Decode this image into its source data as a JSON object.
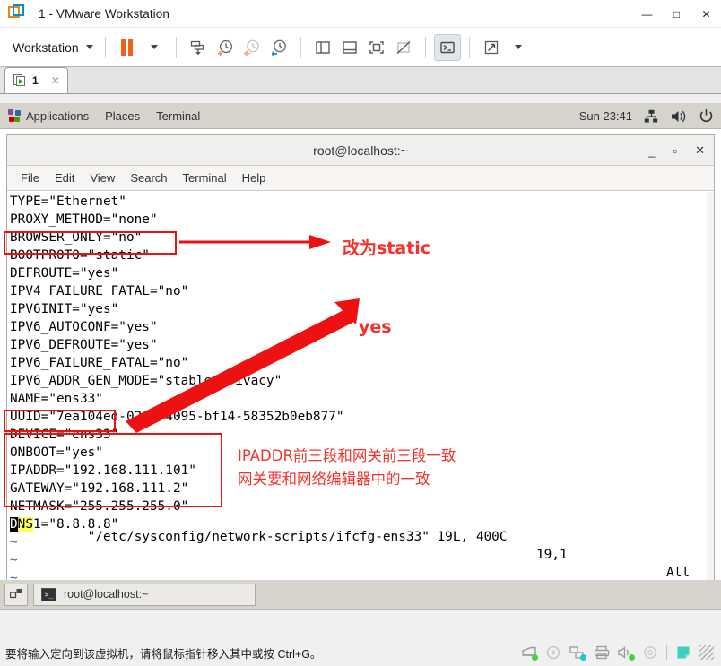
{
  "window": {
    "title": "1 - VMware Workstation",
    "logo_icon": "vmware-logo-icon",
    "minimize": "—",
    "maximize": "□",
    "close": "✕"
  },
  "toolbar": {
    "workstation_menu": "Workstation",
    "dropdown_caret": "caret-down-icon",
    "buttons": [
      {
        "name": "suspend-button",
        "icon": "pause-icon"
      },
      {
        "name": "power-dropdown-button",
        "icon": "caret-down-icon"
      },
      {
        "name": "snapshot-manager-button",
        "icon": "snapshot-icon"
      },
      {
        "name": "take-snapshot-button",
        "icon": "clock-plus-icon"
      },
      {
        "name": "revert-snapshot-button",
        "icon": "clock-back-icon"
      },
      {
        "name": "manage-snapshots-button",
        "icon": "clock-wrench-icon"
      },
      {
        "name": "show-library-button",
        "icon": "panel-left-icon"
      },
      {
        "name": "show-thumbnail-bar-button",
        "icon": "panel-bottom-icon"
      },
      {
        "name": "show-console-view-button",
        "icon": "fullscreen-box-icon"
      },
      {
        "name": "hide-console-view-button",
        "icon": "box-slash-icon"
      },
      {
        "name": "send-ctrl-alt-del-button",
        "icon": "terminal-prompt-icon"
      },
      {
        "name": "enter-fullscreen-button",
        "icon": "expand-arrows-icon"
      },
      {
        "name": "unity-dropdown-button",
        "icon": "caret-down-icon"
      }
    ]
  },
  "vm_tab": {
    "label": "1",
    "icon": "vm-running-icon",
    "close": "✕"
  },
  "guest": {
    "panel": {
      "applications": "Applications",
      "places": "Places",
      "terminal": "Terminal",
      "apps_icon": "gnome-applications-icon",
      "clock": "Sun 23:41",
      "network_icon": "network-icon",
      "volume_icon": "volume-icon",
      "power_icon": "power-icon"
    },
    "terminal": {
      "title": "root@localhost:~",
      "window_buttons": {
        "minimize": "_",
        "maximize": "▫",
        "close": "✕"
      },
      "menus": [
        "File",
        "Edit",
        "View",
        "Search",
        "Terminal",
        "Help"
      ],
      "lines": [
        "TYPE=\"Ethernet\"",
        "PROXY_METHOD=\"none\"",
        "BROWSER_ONLY=\"no\"",
        "BOOTPROTO=\"static\"",
        "DEFROUTE=\"yes\"",
        "IPV4_FAILURE_FATAL=\"no\"",
        "IPV6INIT=\"yes\"",
        "IPV6_AUTOCONF=\"yes\"",
        "IPV6_DEFROUTE=\"yes\"",
        "IPV6_FAILURE_FATAL=\"no\"",
        "IPV6_ADDR_GEN_MODE=\"stable-privacy\"",
        "NAME=\"ens33\"",
        "UUID=\"7ea104ed-026c-4095-bf14-58352b0eb877\"",
        "DEVICE=\"ens33\"",
        "ONBOOT=\"yes\"",
        "IPADDR=\"192.168.111.101\"",
        "GATEWAY=\"192.168.111.2\"",
        "NETMASK=\"255.255.255.0\""
      ],
      "dns_line": {
        "cursor_char": "D",
        "highlight": "NS",
        "rest": "1=\"8.8.8.8\""
      },
      "empty_markers": [
        "~",
        "~",
        "~",
        "~",
        "~"
      ],
      "status": {
        "file": "\"/etc/sysconfig/network-scripts/ifcfg-ens33\" 19L, 400C",
        "position": "19,1",
        "view": "All"
      }
    },
    "taskbar": {
      "show_desktop_icon": "show-desktop-icon",
      "task_title": "root@localhost:~",
      "task_icon": "terminal-icon"
    }
  },
  "annotations": [
    {
      "name": "annotation-bootproto",
      "text": "改为static",
      "color": "#f3332b"
    },
    {
      "name": "annotation-onboot",
      "text": "yes",
      "color": "#f3332b"
    },
    {
      "name": "annotation-ipaddr-line1",
      "text": "IPADDR前三段和网关前三段一致",
      "color": "#f3332b"
    },
    {
      "name": "annotation-ipaddr-line2",
      "text": "网关要和网络编辑器中的一致",
      "color": "#f3332b"
    }
  ],
  "status_bar": {
    "message": "要将输入定向到该虚拟机，请将鼠标指针移入其中或按 Ctrl+G。",
    "device_icons": [
      {
        "name": "hard-disk-icon",
        "state": "green"
      },
      {
        "name": "cd-dvd-icon",
        "state": "none"
      },
      {
        "name": "network-adapter-icon",
        "state": "cyan"
      },
      {
        "name": "printer-icon",
        "state": "none"
      },
      {
        "name": "sound-card-icon",
        "state": "green"
      },
      {
        "name": "camera-icon",
        "state": "none"
      },
      {
        "name": "note-icon",
        "state": "none"
      }
    ]
  },
  "colors": {
    "accent_orange": "#f0631e",
    "annotation_red": "#f3332b",
    "highlight_yellow": "#ffff5c",
    "vim_tilde_blue": "#3465a4"
  }
}
